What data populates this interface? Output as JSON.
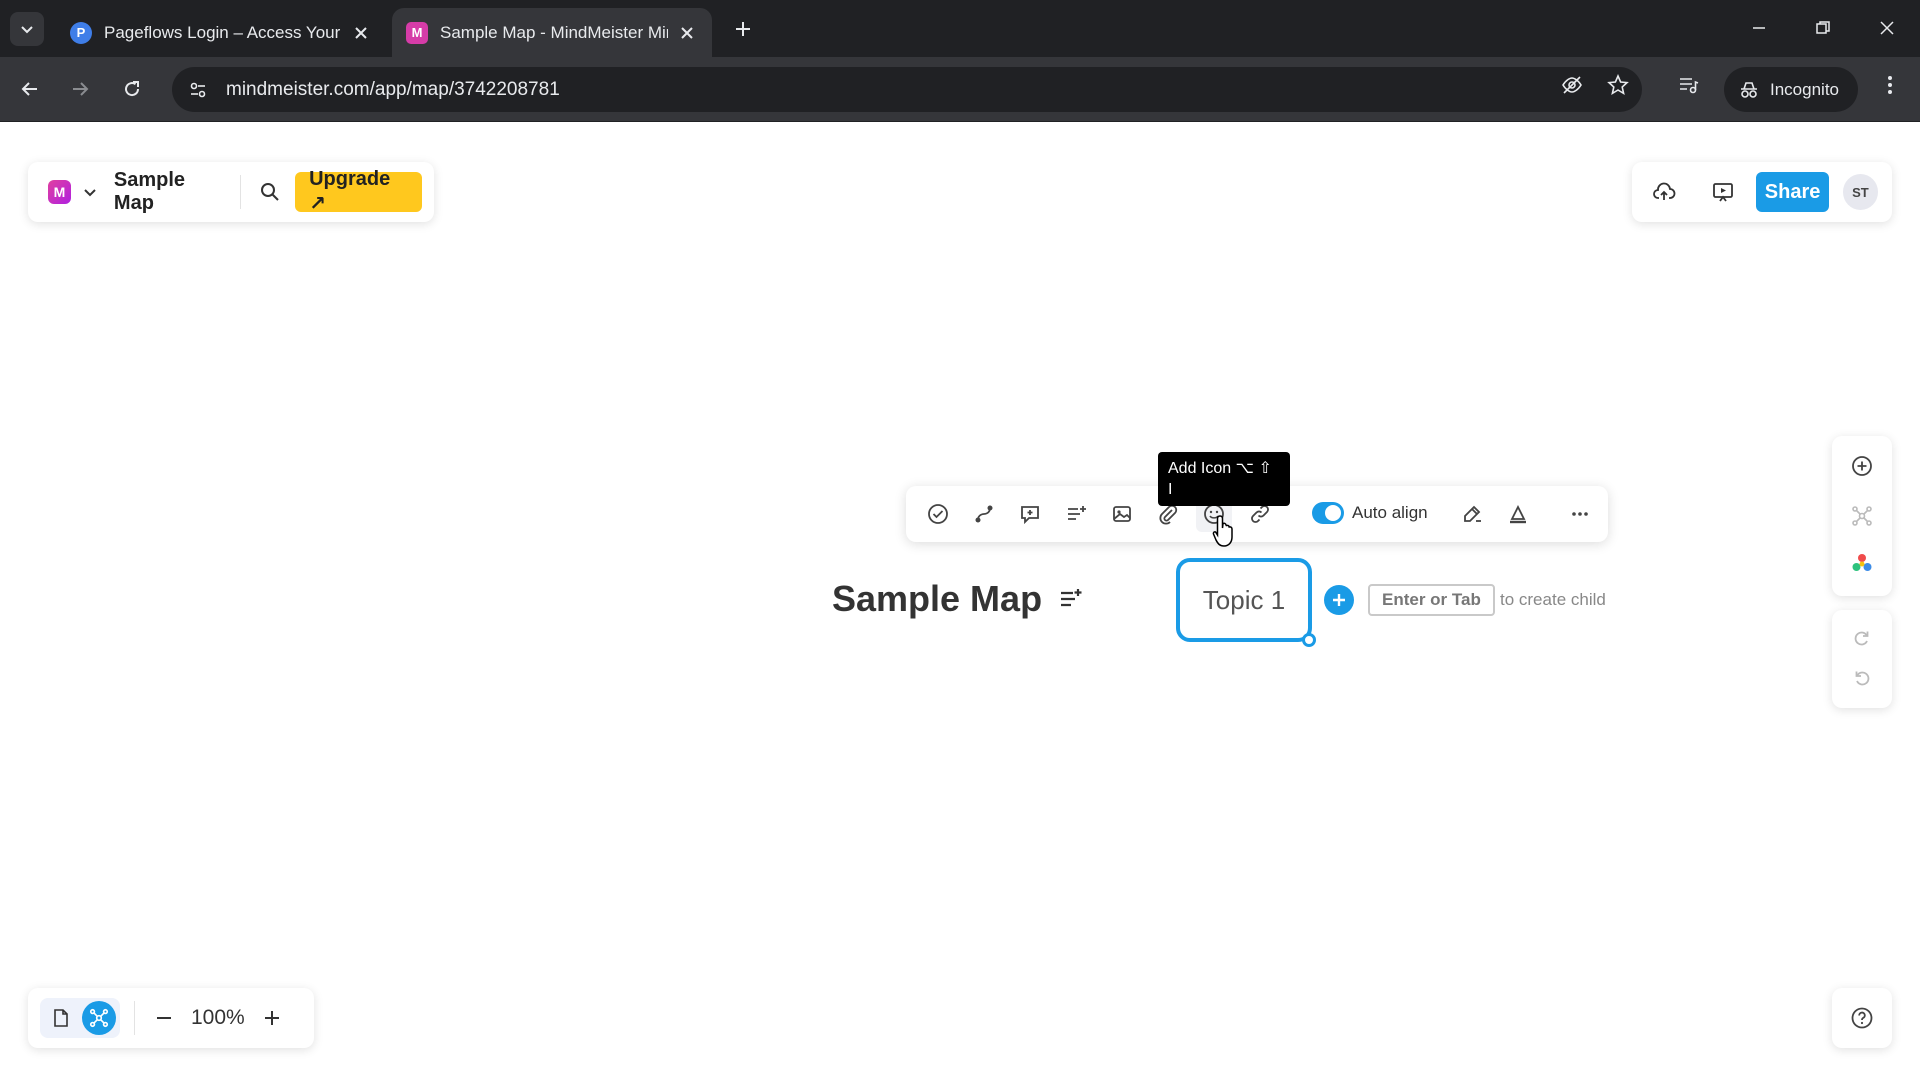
{
  "browser": {
    "tabs": [
      {
        "favicon": "P",
        "title": "Pageflows Login – Access Your I",
        "active": false
      },
      {
        "favicon": "M",
        "title": "Sample Map - MindMeister Min",
        "active": true
      }
    ],
    "url": "mindmeister.com/app/map/3742208781",
    "incognito_label": "Incognito"
  },
  "header": {
    "logo": "M",
    "map_title": "Sample Map",
    "upgrade_label": "Upgrade ↗",
    "share_label": "Share",
    "avatar_initials": "ST"
  },
  "toolbar": {
    "auto_align_label": "Auto align",
    "auto_align_on": true,
    "tooltip_line1": "Add Icon ⌥ ⇧",
    "tooltip_line2": "I"
  },
  "canvas": {
    "central_topic": "Sample Map",
    "topic_1": "Topic 1",
    "key_hint": "Enter or Tab",
    "hint_text": "to create child"
  },
  "zoom": {
    "level": "100%"
  },
  "colors": {
    "accent": "#1a9be6",
    "upgrade": "#ffc81e",
    "chrome_dark": "#202124",
    "chrome_mid": "#35363a"
  }
}
